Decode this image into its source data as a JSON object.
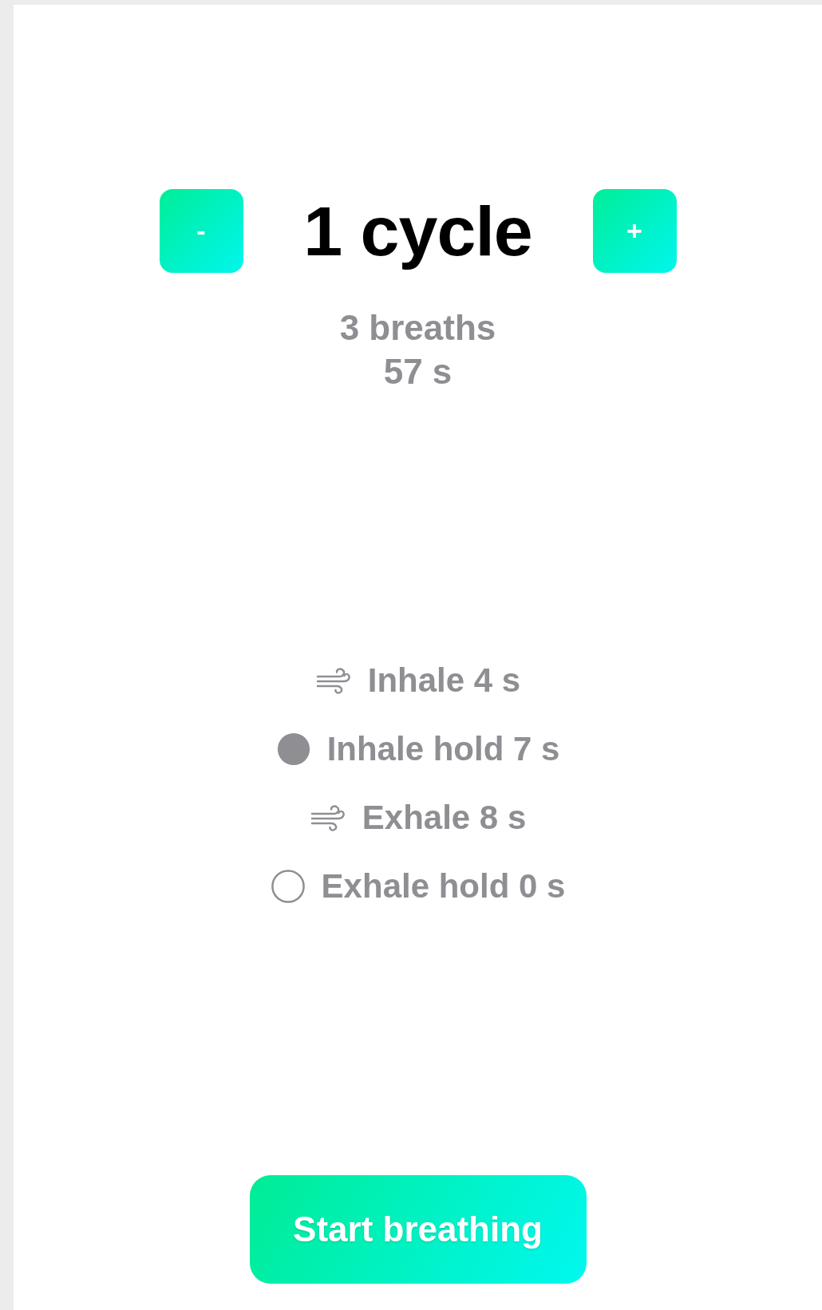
{
  "counter": {
    "decrement": "-",
    "title": "1 cycle",
    "increment": "+"
  },
  "summary": {
    "breaths": "3 breaths",
    "duration": "57 s"
  },
  "phases": [
    {
      "kind": "wind",
      "label": "Inhale 4 s"
    },
    {
      "kind": "dot",
      "label": "Inhale hold 7 s"
    },
    {
      "kind": "wind",
      "label": "Exhale 8 s"
    },
    {
      "kind": "ring",
      "label": "Exhale hold 0 s"
    }
  ],
  "start_button": "Start breathing"
}
